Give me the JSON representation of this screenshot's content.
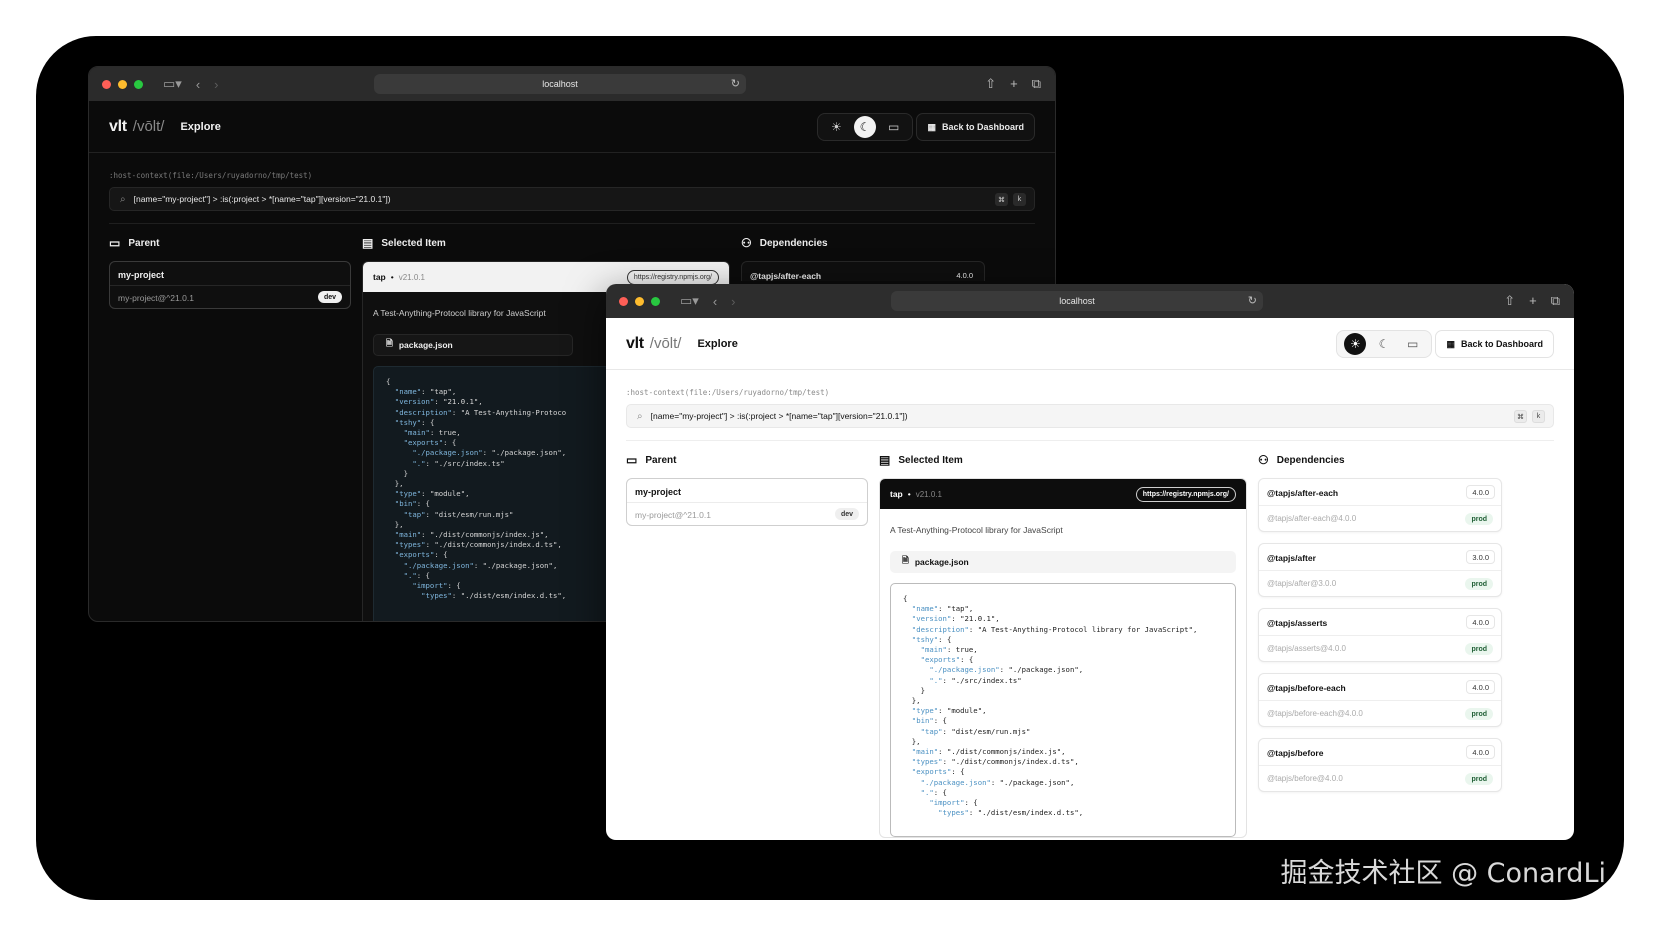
{
  "browser": {
    "url": "localhost"
  },
  "app": {
    "logo": "vlt",
    "logo_sub": "/vōlt/",
    "nav_explore": "Explore",
    "back_button": "Back to Dashboard",
    "host_context": ":host-context(file:/Users/ruyadorno/tmp/test)",
    "query": "[name=\"my-project\"] > :is(:project > *[name=\"tap\"][version=\"21.0.1\"])",
    "kbd_cmd": "⌘",
    "kbd_k": "k"
  },
  "columns": {
    "parent": "Parent",
    "selected": "Selected Item",
    "dependencies": "Dependencies"
  },
  "parent": {
    "name": "my-project",
    "spec": "my-project@^21.0.1",
    "badge": "dev"
  },
  "selected": {
    "name": "tap",
    "dot": "•",
    "version": "v21.0.1",
    "registry": "https://registry.npmjs.org/",
    "description": "A Test-Anything-Protocol library for JavaScript",
    "file_tab": "package.json"
  },
  "code_lines_light": [
    "{",
    "  \"name\": \"tap\",",
    "  \"version\": \"21.0.1\",",
    "  \"description\": \"A Test-Anything-Protocol library for JavaScript\",",
    "  \"tshy\": {",
    "    \"main\": true,",
    "    \"exports\": {",
    "      \"./package.json\": \"./package.json\",",
    "      \".\": \"./src/index.ts\"",
    "    }",
    "  },",
    "  \"type\": \"module\",",
    "  \"bin\": {",
    "    \"tap\": \"dist/esm/run.mjs\"",
    "  },",
    "  \"main\": \"./dist/commonjs/index.js\",",
    "  \"types\": \"./dist/commonjs/index.d.ts\",",
    "  \"exports\": {",
    "    \"./package.json\": \"./package.json\",",
    "    \".\": {",
    "      \"import\": {",
    "        \"types\": \"./dist/esm/index.d.ts\","
  ],
  "code_lines_dark": [
    "{",
    "  \"name\": \"tap\",",
    "  \"version\": \"21.0.1\",",
    "  \"description\": \"A Test-Anything-Protoco",
    "  \"tshy\": {",
    "    \"main\": true,",
    "    \"exports\": {",
    "      \"./package.json\": \"./package.json\",",
    "      \".\": \"./src/index.ts\"",
    "    }",
    "  },",
    "  \"type\": \"module\",",
    "  \"bin\": {",
    "    \"tap\": \"dist/esm/run.mjs\"",
    "  },",
    "  \"main\": \"./dist/commonjs/index.js\",",
    "  \"types\": \"./dist/commonjs/index.d.ts\",",
    "  \"exports\": {",
    "    \"./package.json\": \"./package.json\",",
    "    \".\": {",
    "      \"import\": {",
    "        \"types\": \"./dist/esm/index.d.ts\","
  ],
  "dependencies": [
    {
      "name": "@tapjs/after-each",
      "version": "4.0.0",
      "spec": "@tapjs/after-each@4.0.0",
      "badge": "prod"
    },
    {
      "name": "@tapjs/after",
      "version": "3.0.0",
      "spec": "@tapjs/after@3.0.0",
      "badge": "prod"
    },
    {
      "name": "@tapjs/asserts",
      "version": "4.0.0",
      "spec": "@tapjs/asserts@4.0.0",
      "badge": "prod"
    },
    {
      "name": "@tapjs/before-each",
      "version": "4.0.0",
      "spec": "@tapjs/before-each@4.0.0",
      "badge": "prod"
    },
    {
      "name": "@tapjs/before",
      "version": "4.0.0",
      "spec": "@tapjs/before@4.0.0",
      "badge": "prod"
    }
  ],
  "watermark": "掘金技术社区 @ ConardLi",
  "colors": {
    "accent_dark": "#0b0b0b",
    "accent_light": "#ffffff",
    "prod_badge_bg": "#eaf6ee"
  }
}
